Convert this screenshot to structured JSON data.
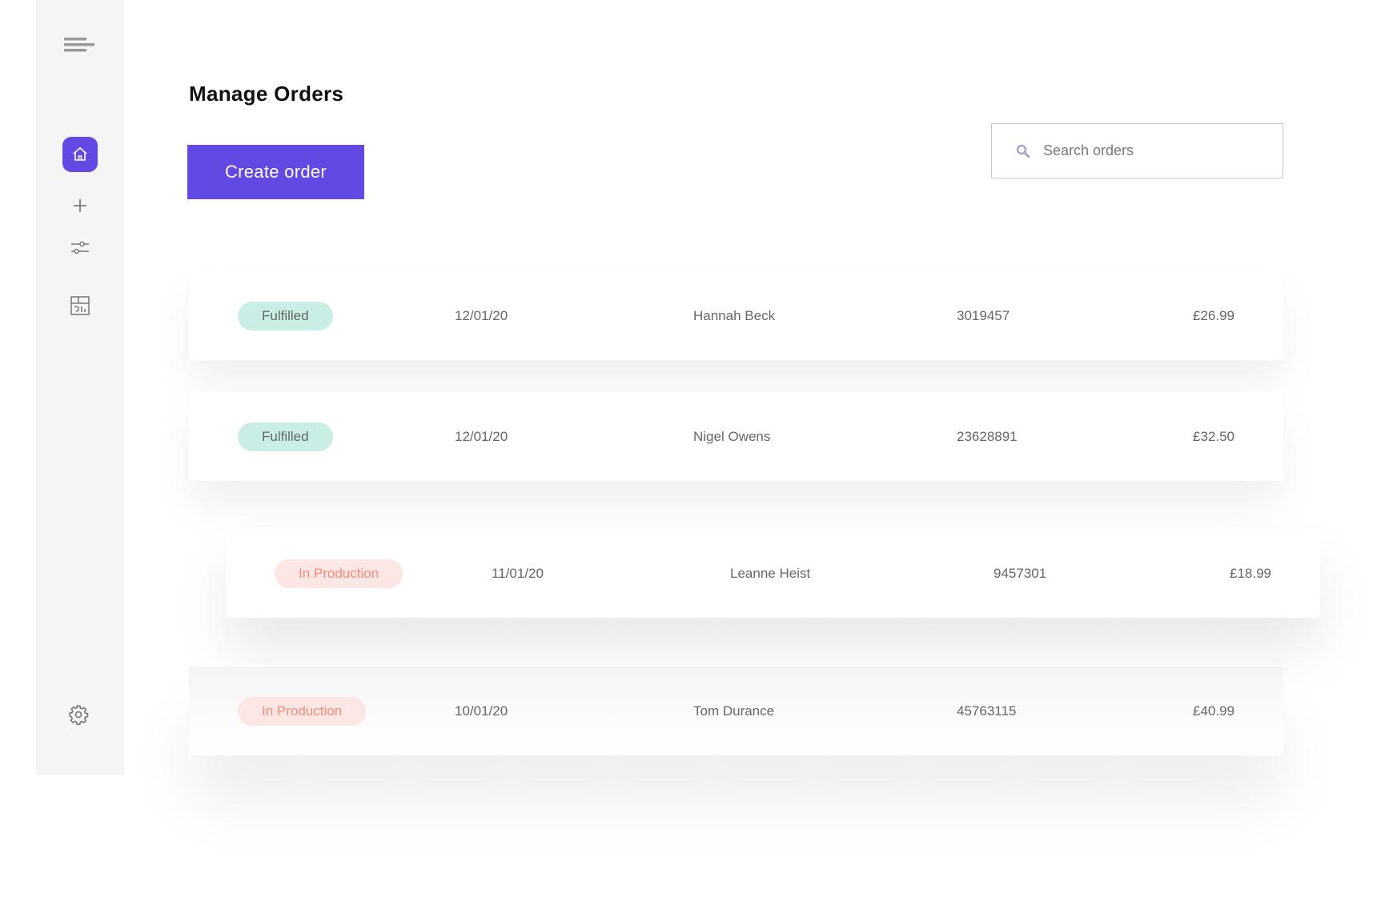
{
  "colors": {
    "accent": "#6349e3",
    "fulfilled_bg": "#c9eee6",
    "production_bg": "#fde7e4",
    "production_text": "#f58a7a"
  },
  "sidebar": {
    "items": [
      {
        "icon": "menu-icon"
      },
      {
        "icon": "home-icon",
        "active": true
      },
      {
        "icon": "plus-icon"
      },
      {
        "icon": "sliders-icon"
      },
      {
        "icon": "report-icon"
      },
      {
        "icon": "gear-icon"
      }
    ]
  },
  "header": {
    "title": "Manage Orders",
    "create_label": "Create order"
  },
  "search": {
    "placeholder": "Search orders",
    "value": "",
    "icon": "search-icon"
  },
  "orders": [
    {
      "status": "Fulfilled",
      "date": "12/01/20",
      "name": "Hannah Beck",
      "id": "3019457",
      "price": "£26.99"
    },
    {
      "status": "Fulfilled",
      "date": "12/01/20",
      "name": "Nigel Owens",
      "id": "23628891",
      "price": "£32.50"
    },
    {
      "status": "In Production",
      "date": "11/01/20",
      "name": "Leanne Heist",
      "id": "9457301",
      "price": "£18.99"
    },
    {
      "status": "In Production",
      "date": "10/01/20",
      "name": "Tom Durance",
      "id": "45763115",
      "price": "£40.99"
    }
  ]
}
